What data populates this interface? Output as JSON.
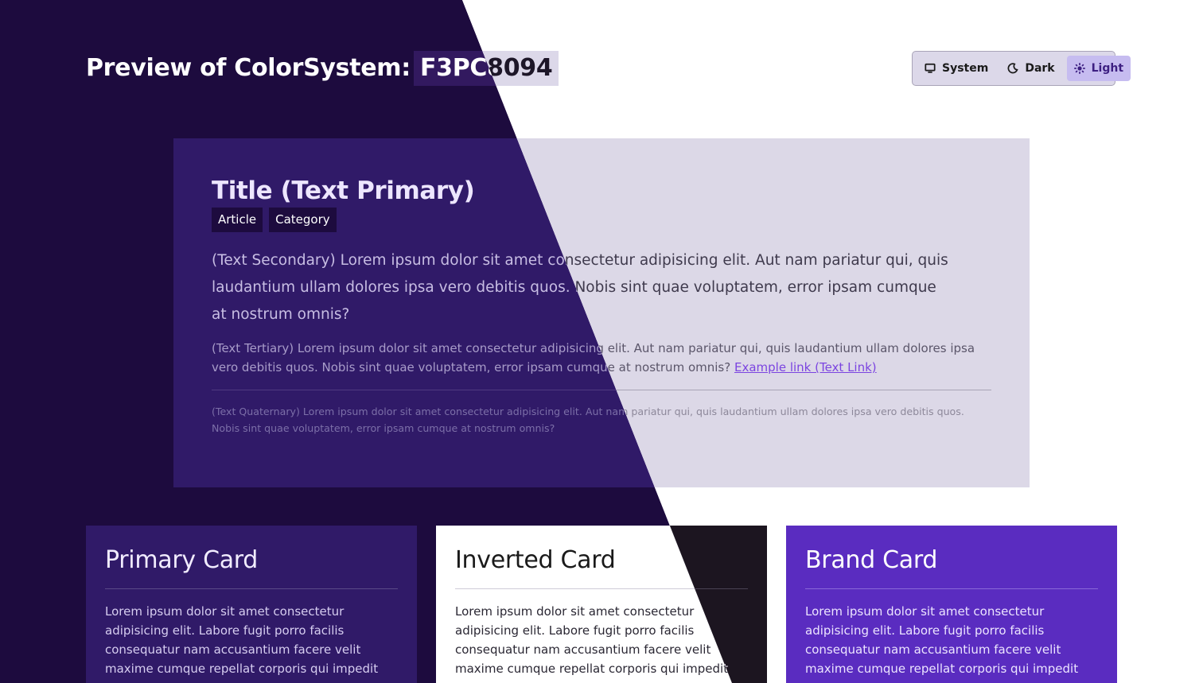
{
  "header": {
    "title_prefix": "Preview of ColorSystem:",
    "code": "F3PC8094"
  },
  "theme_switcher": {
    "options": [
      {
        "label": "System",
        "icon": "monitor-icon"
      },
      {
        "label": "Dark",
        "icon": "moon-icon"
      },
      {
        "label": "Light",
        "icon": "sun-icon"
      }
    ],
    "selected": "Light"
  },
  "article": {
    "title": "Title (Text Primary)",
    "tags": [
      "Article",
      "Category"
    ],
    "text_secondary": "(Text Secondary) Lorem ipsum dolor sit amet consectetur adipisicing elit. Aut nam pariatur qui, quis laudantium ullam dolores ipsa vero debitis quos. Nobis sint quae voluptatem, error ipsam cumque at nostrum omnis?",
    "text_tertiary": "(Text Tertiary) Lorem ipsum dolor sit amet consectetur adipisicing elit. Aut nam pariatur qui, quis laudantium ullam dolores ipsa vero debitis quos. Nobis sint quae voluptatem, error ipsam cumque at nostrum omnis?",
    "link_label": "Example link (Text Link)",
    "text_quaternary": "(Text Quaternary) Lorem ipsum dolor sit amet consectetur adipisicing elit. Aut nam pariatur qui, quis laudantium ullam dolores ipsa vero debitis quos. Nobis sint quae voluptatem, error ipsam cumque at nostrum omnis?"
  },
  "cards": {
    "primary": {
      "title": "Primary Card",
      "body": "Lorem ipsum dolor sit amet consectetur adipisicing elit. Labore fugit porro facilis consequatur nam accusantium facere velit maxime cumque repellat corporis qui impedit"
    },
    "inverted": {
      "title": "Inverted Card",
      "body": "Lorem ipsum dolor sit amet consectetur adipisicing elit. Labore fugit porro facilis consequatur nam accusantium facere velit maxime cumque repellat corporis qui impedit"
    },
    "brand": {
      "title": "Brand Card",
      "body": "Lorem ipsum dolor sit amet consectetur adipisicing elit. Labore fugit porro facilis consequatur nam accusantium facere velit maxime cumque repellat corporis qui impedit"
    }
  },
  "colors": {
    "dark_background": "#1d0b3e",
    "light_background": "#ffffff",
    "brand": "#5a2cc0",
    "link": "#7b44e0"
  }
}
